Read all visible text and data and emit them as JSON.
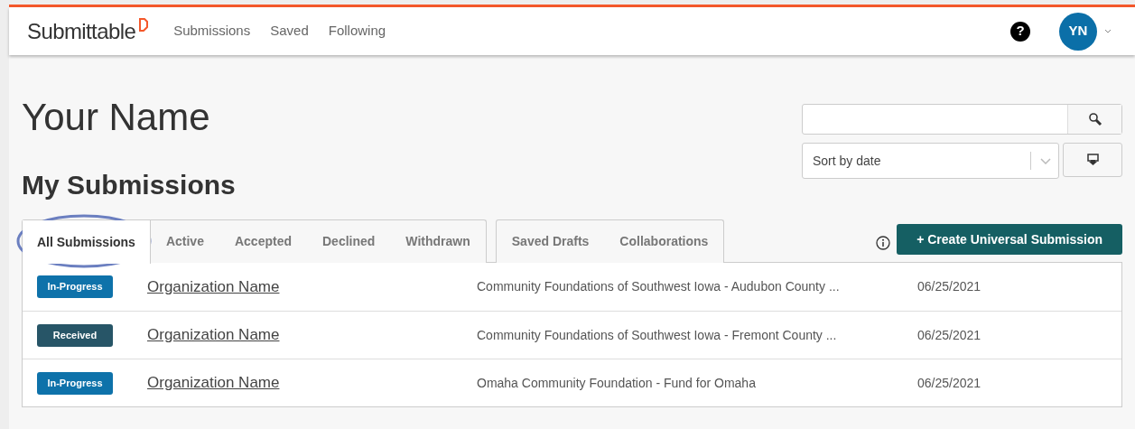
{
  "header": {
    "logo": "Submittable",
    "nav": [
      {
        "label": "Submissions"
      },
      {
        "label": "Saved"
      },
      {
        "label": "Following"
      }
    ],
    "help": "?",
    "avatar": "YN"
  },
  "page": {
    "title": "Your Name",
    "subtitle": "My Submissions"
  },
  "sort": {
    "value": "Sort by date"
  },
  "tab_groups": [
    [
      {
        "label": "All Submissions",
        "selected": true
      },
      {
        "label": "Active",
        "selected": false
      },
      {
        "label": "Accepted",
        "selected": false
      },
      {
        "label": "Declined",
        "selected": false
      },
      {
        "label": "Withdrawn",
        "selected": false
      }
    ],
    [
      {
        "label": "Saved Drafts",
        "selected": false
      },
      {
        "label": "Collaborations",
        "selected": false
      }
    ]
  ],
  "create_button": "+ Create Universal Submission",
  "rows": [
    {
      "status": "In-Progress",
      "color": "#0e72aa",
      "organization": "Organization Name",
      "form": "Community Foundations of Southwest Iowa - Audubon County ...",
      "date": "06/25/2021"
    },
    {
      "status": "Received",
      "color": "#275567",
      "organization": "Organization Name",
      "form": "Community Foundations of Southwest Iowa - Fremont County ...",
      "date": "06/25/2021"
    },
    {
      "status": "In-Progress",
      "color": "#0e72aa",
      "organization": "Organization Name",
      "form": "Omaha Community Foundation - Fund for Omaha",
      "date": "06/25/2021"
    }
  ]
}
